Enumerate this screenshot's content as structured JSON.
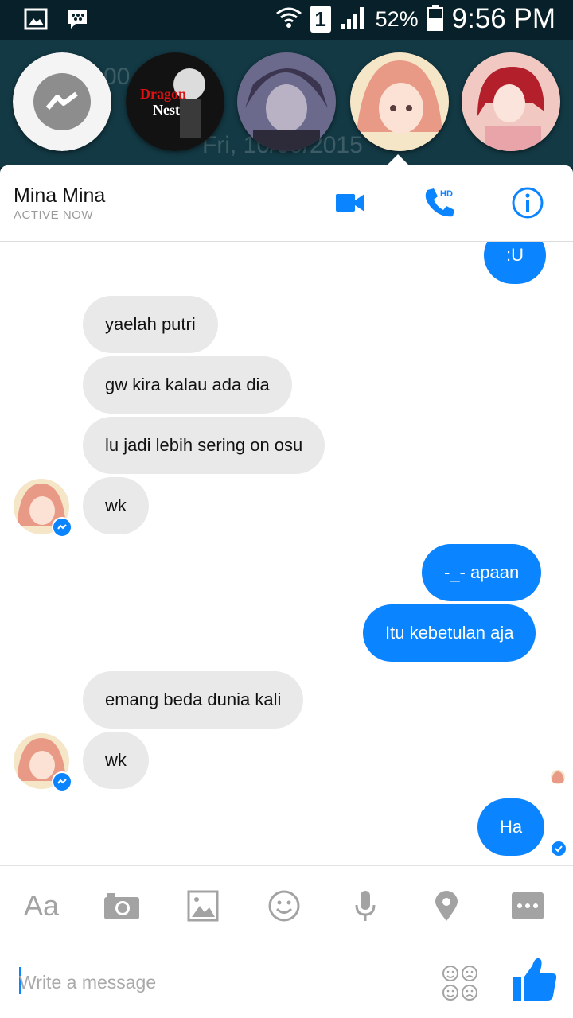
{
  "status_bar": {
    "battery": "52%",
    "time": "9:56 PM",
    "sim_slot": "1"
  },
  "background_hint": {
    "number": "00",
    "date": "Fri, 10/09/2015"
  },
  "chat_heads": [
    {
      "name": "messenger-head"
    },
    {
      "name": "dragon-nest-head",
      "text": "Dragon Nest"
    },
    {
      "name": "dark-anime-head"
    },
    {
      "name": "mina-head"
    },
    {
      "name": "red-anime-head"
    }
  ],
  "conversation": {
    "name": "Mina Mina",
    "status": "ACTIVE NOW"
  },
  "messages": [
    {
      "side": "out",
      "text": ":U"
    },
    {
      "side": "in",
      "text": "yaelah putri"
    },
    {
      "side": "in",
      "text": "gw kira kalau ada dia"
    },
    {
      "side": "in",
      "text": "lu jadi lebih sering on osu"
    },
    {
      "side": "in",
      "text": "wk"
    },
    {
      "side": "out",
      "text": "-_- apaan"
    },
    {
      "side": "out",
      "text": "Itu kebetulan aja"
    },
    {
      "side": "in",
      "text": "emang beda dunia kali"
    },
    {
      "side": "in",
      "text": "wk"
    },
    {
      "side": "out",
      "text": "Ha"
    }
  ],
  "toolbar": {
    "text_format_label": "Aa"
  },
  "composer": {
    "placeholder": "Write a message"
  },
  "colors": {
    "accent": "#0b84ff",
    "incoming_bubble": "#e9e9e9"
  }
}
